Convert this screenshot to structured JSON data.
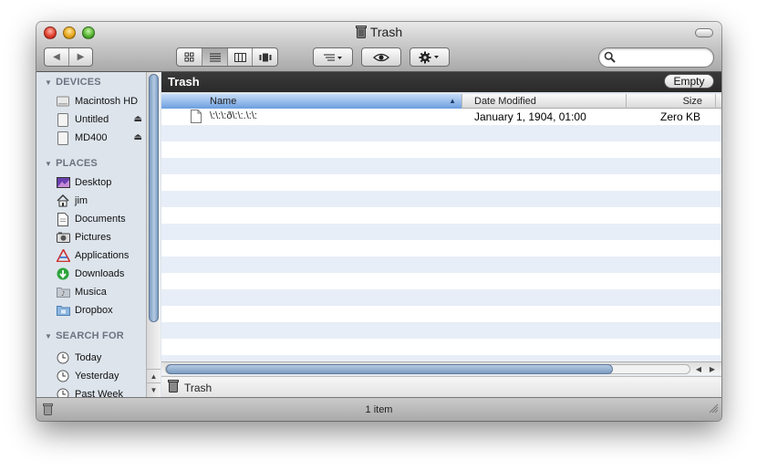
{
  "window": {
    "title": "Trash",
    "title_icon": "trash-icon"
  },
  "toolbar": {
    "back_icon": "back-arrow-icon",
    "forward_icon": "forward-arrow-icon",
    "view_modes": [
      "icon-view",
      "list-view",
      "column-view",
      "cover-flow-view"
    ],
    "active_view": "list-view",
    "search": {
      "value": "",
      "placeholder": ""
    }
  },
  "sidebar": {
    "sections": [
      {
        "title": "DEVICES",
        "items": [
          {
            "label": "Macintosh HD",
            "icon": "hard-drive-icon",
            "eject": false
          },
          {
            "label": "Untitled",
            "icon": "disk-icon",
            "eject": true
          },
          {
            "label": "MD400",
            "icon": "disk-icon",
            "eject": true
          }
        ]
      },
      {
        "title": "PLACES",
        "items": [
          {
            "label": "Desktop",
            "icon": "desktop-icon"
          },
          {
            "label": "jim",
            "icon": "home-icon"
          },
          {
            "label": "Documents",
            "icon": "documents-icon"
          },
          {
            "label": "Pictures",
            "icon": "pictures-icon"
          },
          {
            "label": "Applications",
            "icon": "applications-icon"
          },
          {
            "label": "Downloads",
            "icon": "downloads-icon"
          },
          {
            "label": "Musica",
            "icon": "music-folder-icon"
          },
          {
            "label": "Dropbox",
            "icon": "dropbox-folder-icon"
          }
        ]
      },
      {
        "title": "SEARCH FOR",
        "items": [
          {
            "label": "Today",
            "icon": "clock-icon"
          },
          {
            "label": "Yesterday",
            "icon": "clock-icon"
          },
          {
            "label": "Past Week",
            "icon": "clock-icon"
          }
        ]
      }
    ]
  },
  "main": {
    "path_title": "Trash",
    "empty_label": "Empty",
    "columns": {
      "name": "Name",
      "date": "Date Modified",
      "size": "Size"
    },
    "files": [
      {
        "name": "\\:\\:\\:ð\\:\\:.\\:\\:",
        "date": "January 1, 1904, 01:00",
        "size": "Zero KB"
      }
    ],
    "bottom_path": "Trash"
  },
  "status": {
    "text": "1 item"
  },
  "colors": {
    "selection_blue": "#6c9fe0",
    "stripe": "#e8eef8",
    "sidebar_bg": "#dde4ec"
  }
}
